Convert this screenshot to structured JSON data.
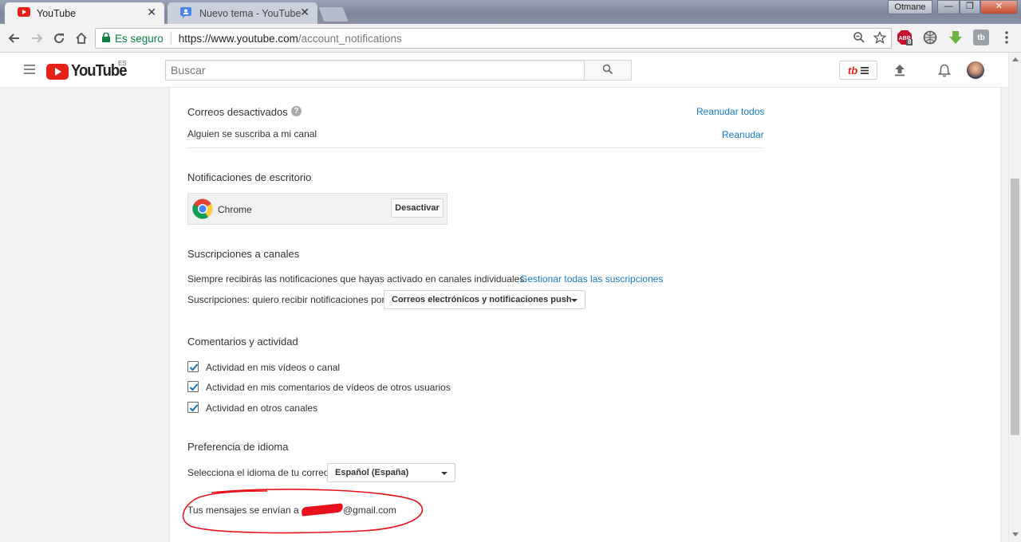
{
  "window": {
    "user_label": "Otmane",
    "minimize_glyph": "—",
    "maximize_glyph": "❐",
    "close_glyph": "✕"
  },
  "tabs": [
    {
      "title": "YouTube",
      "active": true,
      "close": "✕"
    },
    {
      "title": "Nuevo tema - YouTube ·",
      "active": false,
      "close": "✕"
    }
  ],
  "browser": {
    "secure_label": "Es seguro",
    "url_scheme": "https://",
    "url_host": "www.youtube.com",
    "url_path": "/account_notifications",
    "abp_badge": "8",
    "tb_ext_label": "tb"
  },
  "header": {
    "logo_text": "YouTube",
    "country_code": "ES",
    "search_placeholder": "Buscar",
    "tb_label": "tb"
  },
  "disabled_emails": {
    "title": "Correos desactivados",
    "help_glyph": "?",
    "resume_all": "Reanudar todos",
    "item_label": "Alguien se suscriba a mi canal",
    "item_action": "Reanudar"
  },
  "desktop_notifications": {
    "title": "Notificaciones de escritorio",
    "browser_name": "Chrome",
    "button_label": "Desactivar"
  },
  "channel_subscriptions": {
    "title": "Suscripciones a canales",
    "description": "Siempre recibirás las notificaciones que hayas activado en canales individuales.",
    "manage_link": "Gestionar todas las suscripciones",
    "select_label": "Suscripciones: quiero recibir notificaciones por",
    "select_value": "Correos electrónicos y notificaciones push"
  },
  "comments_activity": {
    "title": "Comentarios y actividad",
    "items": [
      {
        "label": "Actividad en mis vídeos o canal",
        "checked": true
      },
      {
        "label": "Actividad en mis comentarios de vídeos de otros usuarios",
        "checked": true
      },
      {
        "label": "Actividad en otros canales",
        "checked": true
      }
    ]
  },
  "language": {
    "title": "Preferencia de idioma",
    "select_label": "Selecciona el idioma de tu correo",
    "select_value": "Español (España)"
  },
  "email_footer": {
    "prefix": "Tus mensajes se envían a",
    "suffix": "@gmail.com"
  },
  "colors": {
    "youtube_red": "#e62117",
    "link_blue": "#167ac6",
    "secure_green": "#0b8043",
    "annotation_red": "#e8101a"
  }
}
